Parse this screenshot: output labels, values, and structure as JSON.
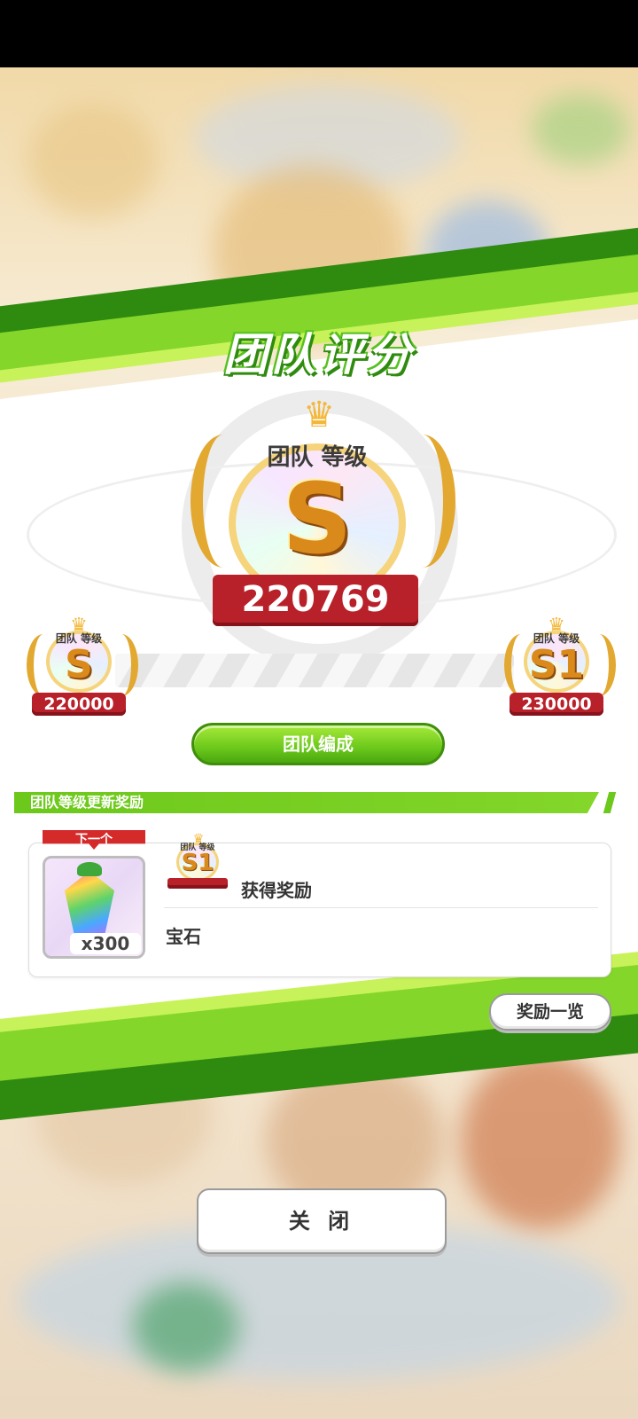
{
  "title": "团队评分",
  "current_rank": {
    "label": "团队 等级",
    "grade": "S",
    "score": "220769"
  },
  "progress": {
    "from": {
      "label": "团队 等级",
      "grade": "S",
      "score": "220000"
    },
    "to": {
      "label": "团队 等级",
      "grade": "S1",
      "score": "230000"
    }
  },
  "team_formation_button": "团队编成",
  "reward_section": {
    "header": "团队等级更新奖励",
    "next_tag": "下一个",
    "rank_badge_label": "团队 等级",
    "rank_badge_grade": "S1",
    "reward_title": "获得奖励",
    "item_name": "宝石",
    "item_quantity": "x300"
  },
  "reward_list_button": "奖励一览",
  "close_button": "关 闭",
  "colors": {
    "accent_green": "#6cc81b",
    "ribbon_red": "#b8202a",
    "gold": "#f3b83b"
  }
}
